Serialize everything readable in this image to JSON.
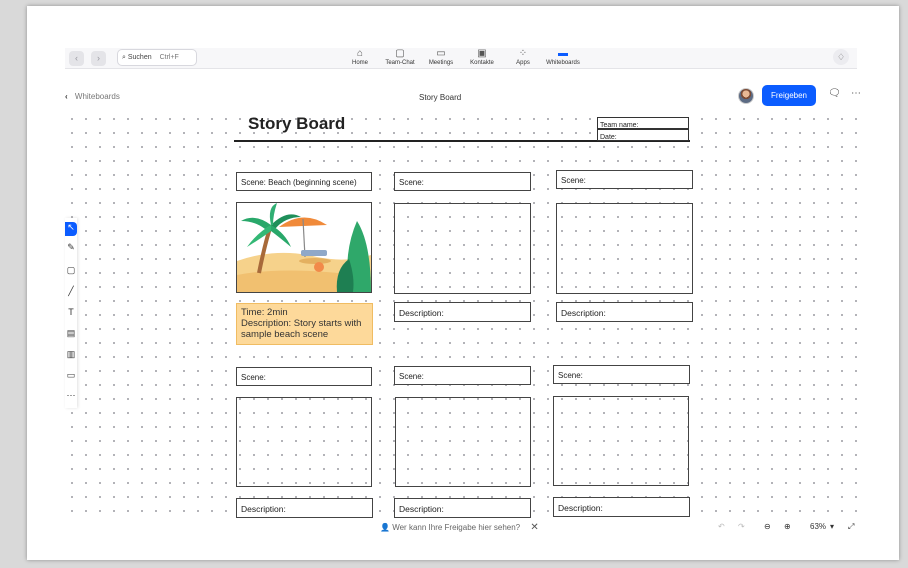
{
  "topbar": {
    "search_label": "Suchen",
    "search_shortcut": "Ctrl+F",
    "nav": [
      {
        "label": "Home",
        "icon": "home-icon"
      },
      {
        "label": "Team-Chat",
        "icon": "chat-bubbles-icon"
      },
      {
        "label": "Meetings",
        "icon": "video-icon"
      },
      {
        "label": "Kontakte",
        "icon": "contacts-icon"
      },
      {
        "label": "Apps",
        "icon": "apps-icon"
      },
      {
        "label": "Whiteboards",
        "icon": "whiteboard-icon",
        "active": true
      }
    ]
  },
  "header": {
    "back_label": "Whiteboards",
    "doc_title": "Story Board",
    "share_label": "Freigeben"
  },
  "board": {
    "title": "Story Board",
    "team_field": "Team name:",
    "date_field": "Date:",
    "row1": {
      "scenes": [
        "Scene: Beach (beginning scene)",
        "Scene:",
        "Scene:"
      ],
      "descriptions": [
        "Description:",
        "Description:"
      ],
      "note": {
        "time": "Time: 2min",
        "description": "Description: Story starts with sample beach scene"
      }
    },
    "row2": {
      "scenes": [
        "Scene:",
        "Scene:",
        "Scene:"
      ],
      "descriptions": [
        "Description:",
        "Description:",
        "Description:"
      ]
    }
  },
  "footer": {
    "share_hint": "Wer kann Ihre Freigabe hier sehen?",
    "zoom": "63%"
  },
  "colors": {
    "accent": "#0b5cff",
    "note_bg": "#fdd99a"
  }
}
